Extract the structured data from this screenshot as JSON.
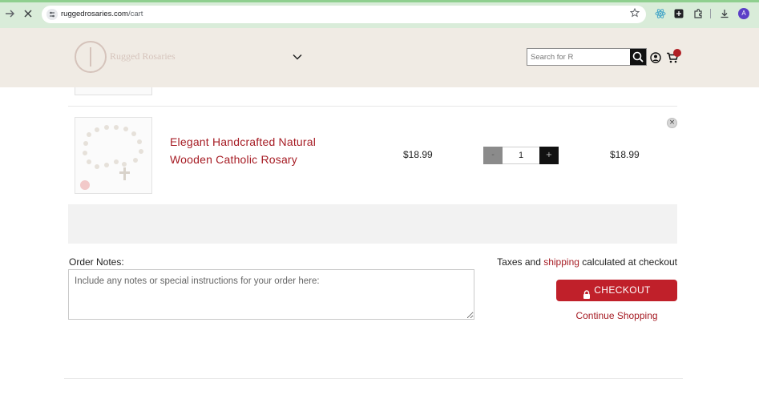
{
  "browser": {
    "url_host": "ruggedrosaries.com",
    "url_path": "/cart",
    "profile_initial": "A",
    "icons": [
      "back-arrow-icon",
      "stop-loading-icon",
      "site-settings-icon",
      "bookmark-star-icon",
      "extension-react-icon",
      "extension-box-icon",
      "extensions-puzzle-icon",
      "download-icon",
      "profile-avatar-icon"
    ]
  },
  "header": {
    "logo_text": "Rugged Rosaries",
    "search_placeholder": "Search for R",
    "icons": [
      "menu-chevron-icon",
      "search-icon",
      "account-icon",
      "cart-icon"
    ]
  },
  "cart": {
    "item": {
      "title": "Elegant Handcrafted Natural Wooden Catholic Rosary",
      "price": "$18.99",
      "quantity": "1",
      "minus_label": "-",
      "plus_label": "+",
      "line_total": "$18.99",
      "remove_label": "×"
    }
  },
  "notes": {
    "label": "Order Notes:",
    "placeholder": "Include any notes or special instructions for your order here:"
  },
  "summary": {
    "tax_prefix": "Taxes and ",
    "tax_link": "shipping",
    "tax_suffix": " calculated at checkout",
    "checkout_label": "CHECKOUT",
    "continue_label": "Continue Shopping"
  },
  "colors": {
    "accent": "#c0202a",
    "link": "#a61c24",
    "header_bg": "#f0ebe4",
    "browser_bar": "#d9ecd9"
  }
}
